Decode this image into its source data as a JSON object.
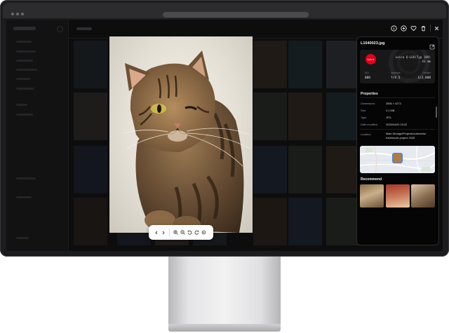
{
  "viewer": {
    "toolbar": {
      "buttons": [
        "chevron-left-icon",
        "chevron-right-icon",
        "zoom-in-icon",
        "zoom-out-icon",
        "rotate-left-icon",
        "rotate-right-icon",
        "reset-zoom-icon"
      ]
    },
    "top_actions": [
      "info-icon",
      "add-icon",
      "favorite-icon",
      "trash-icon",
      "close-icon"
    ]
  },
  "info_panel": {
    "filename": "L1040023.jpg",
    "exif": {
      "brand_logo_text": "Leica",
      "camera_model": "Leica Q-LUX(Typ 109)",
      "focal_length": "43 mm",
      "iso_label": "ISO",
      "iso_value": "800",
      "aperture_label": "Aperture",
      "aperture_value": "f/4.5",
      "shutter_label": "Shutter",
      "shutter_value": "1/2,000"
    },
    "properties": {
      "heading": "Properties",
      "rows": [
        {
          "label": "Dimensions",
          "value": "2856 × 4272"
        },
        {
          "label": "Size",
          "value": "3.1 MB"
        },
        {
          "label": "Type",
          "value": "JPG"
        },
        {
          "label": "Date modified",
          "value": "2025/04/20 15:22"
        }
      ],
      "location_label": "Location",
      "location_lines": [
        "Main-Storage/Projects/cuteshots/",
        "tradhmude.project 2025"
      ]
    },
    "recommend": {
      "heading": "Recommend"
    }
  },
  "colors": {
    "panel_bg": "#050505",
    "accent_pin": "#3b82f6",
    "leica_red": "#e0001b"
  }
}
